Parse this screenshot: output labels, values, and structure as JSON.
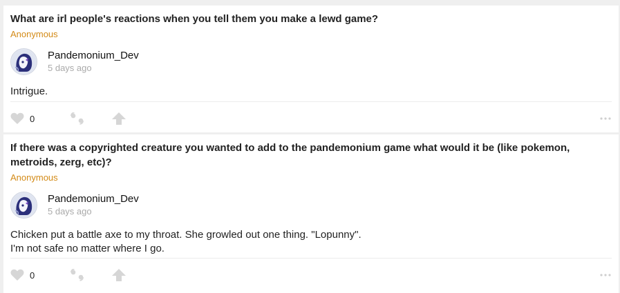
{
  "posts": [
    {
      "question": "What are irl people's reactions when you tell them you make a lewd game?",
      "asker": "Anonymous",
      "author": {
        "name": "Pandemonium_Dev",
        "time": "5 days ago",
        "avatar_icon": "avatar-icon"
      },
      "answer_lines": [
        "Intrigue."
      ],
      "likes": "0"
    },
    {
      "question": "If there was a copyrighted creature you wanted to add to the pandemonium game what would it be (like pokemon, metroids, zerg, etc)?",
      "asker": "Anonymous",
      "author": {
        "name": "Pandemonium_Dev",
        "time": "5 days ago",
        "avatar_icon": "avatar-icon"
      },
      "answer_lines": [
        "Chicken put a battle axe to my throat. She growled out one thing. \"Lopunny\".",
        "I'm not safe no matter where I go."
      ],
      "likes": "0"
    }
  ],
  "colors": {
    "accent": "#d38a16",
    "icon": "#d6d6d6",
    "background": "#efefef"
  }
}
